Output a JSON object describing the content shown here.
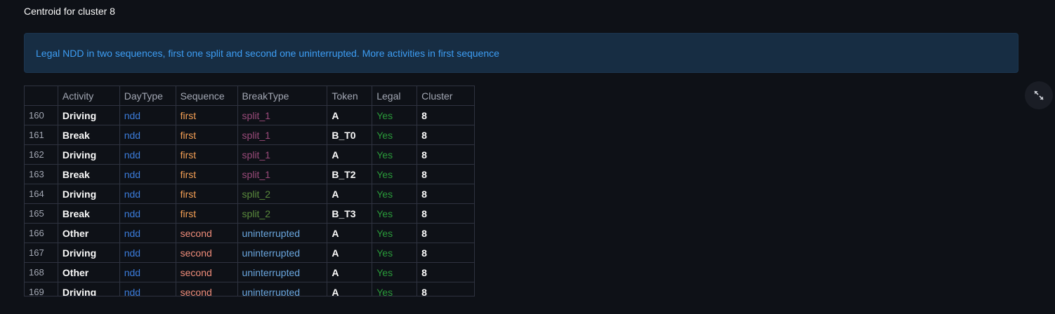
{
  "heading": "Centroid for cluster 8",
  "info": "Legal NDD in two sequences, first one split and second one uninterrupted. More activities in first sequence",
  "table": {
    "columns": [
      "",
      "Activity",
      "DayType",
      "Sequence",
      "BreakType",
      "Token",
      "Legal",
      "Cluster"
    ],
    "rows": [
      [
        "160",
        "Driving",
        "ndd",
        "first",
        "split_1",
        "A",
        "Yes",
        "8"
      ],
      [
        "161",
        "Break",
        "ndd",
        "first",
        "split_1",
        "B_T0",
        "Yes",
        "8"
      ],
      [
        "162",
        "Driving",
        "ndd",
        "first",
        "split_1",
        "A",
        "Yes",
        "8"
      ],
      [
        "163",
        "Break",
        "ndd",
        "first",
        "split_1",
        "B_T2",
        "Yes",
        "8"
      ],
      [
        "164",
        "Driving",
        "ndd",
        "first",
        "split_2",
        "A",
        "Yes",
        "8"
      ],
      [
        "165",
        "Break",
        "ndd",
        "first",
        "split_2",
        "B_T3",
        "Yes",
        "8"
      ],
      [
        "166",
        "Other",
        "ndd",
        "second",
        "uninterrupted",
        "A",
        "Yes",
        "8"
      ],
      [
        "167",
        "Driving",
        "ndd",
        "second",
        "uninterrupted",
        "A",
        "Yes",
        "8"
      ],
      [
        "168",
        "Other",
        "ndd",
        "second",
        "uninterrupted",
        "A",
        "Yes",
        "8"
      ],
      [
        "169",
        "Driving",
        "ndd",
        "second",
        "uninterrupted",
        "A",
        "Yes",
        "8"
      ]
    ]
  },
  "colors": {
    "background": "#0e1117",
    "info_bg": "#172d43",
    "info_text": "#3d9df3"
  },
  "icons": {
    "expand": "expand-icon"
  }
}
